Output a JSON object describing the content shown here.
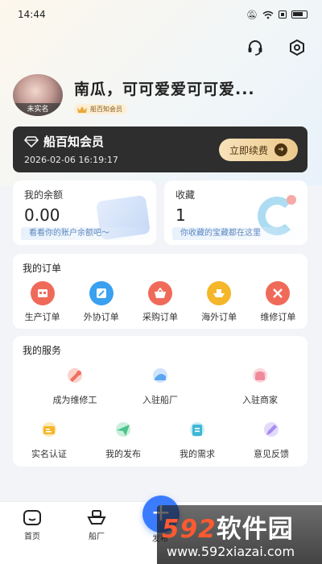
{
  "status_bar": {
    "time": "14:44"
  },
  "profile": {
    "name": "南瓜，可可爱爱可可爱...",
    "avatar_tag": "未实名",
    "member_badge": "船百知会员"
  },
  "vip": {
    "title": "船百知会员",
    "expire_time": "2026-02-06 16:19:17",
    "renew_label": "立即续费"
  },
  "balance": {
    "label": "我的余额",
    "value": "0.00",
    "hint": "看看你的账户余额吧～"
  },
  "favorites": {
    "label": "收藏",
    "value": "1",
    "hint": "你收藏的宝藏都在这里"
  },
  "orders": {
    "title": "我的订单",
    "items": [
      {
        "label": "生产订单",
        "icon": "factory-icon",
        "color": "#f06a5a"
      },
      {
        "label": "外协订单",
        "icon": "edit-icon",
        "color": "#3aa0f0"
      },
      {
        "label": "采购订单",
        "icon": "basket-icon",
        "color": "#f06a5a"
      },
      {
        "label": "海外订单",
        "icon": "ship-icon",
        "color": "#f5b62a"
      },
      {
        "label": "维修订单",
        "icon": "tools-icon",
        "color": "#f06a5a"
      }
    ]
  },
  "services": {
    "title": "我的服务",
    "items": [
      {
        "label": "成为维修工",
        "icon": "wrench-icon",
        "color": "#f0705e"
      },
      {
        "label": "入驻船厂",
        "icon": "dock-icon",
        "color": "#5ba6f0"
      },
      {
        "label": "入驻商家",
        "icon": "store-icon",
        "color": "#f08a9a"
      },
      {
        "label": "实名认证",
        "icon": "id-card-icon",
        "color": "#f5b62a"
      },
      {
        "label": "我的发布",
        "icon": "send-icon",
        "color": "#4cc38a"
      },
      {
        "label": "我的需求",
        "icon": "list-icon",
        "color": "#3fb7d6"
      },
      {
        "label": "意见反馈",
        "icon": "pen-icon",
        "color": "#a58af0"
      }
    ]
  },
  "tabbar": {
    "home": "首页",
    "shipyard": "船厂",
    "publish": "发布"
  },
  "watermark": {
    "brand_num": "592",
    "brand_text": "软件园",
    "url": "www.592xiazai.com"
  }
}
